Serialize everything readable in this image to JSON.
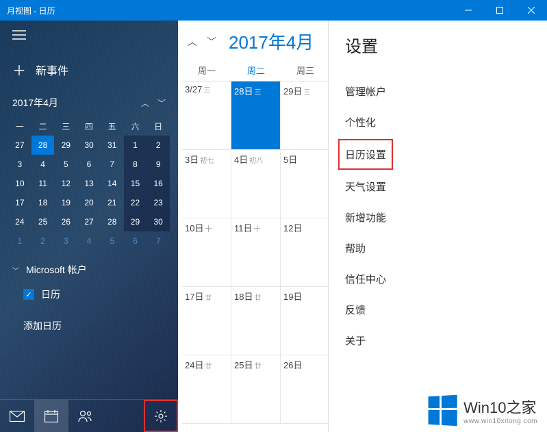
{
  "titlebar": {
    "title": "月视图 - 日历"
  },
  "sidebar": {
    "new_event": "新事件",
    "mini_month": "2017年4月",
    "dow": [
      "一",
      "二",
      "三",
      "四",
      "五",
      "六",
      "日"
    ],
    "weeks": [
      [
        {
          "n": "27",
          "p": true
        },
        {
          "n": "28",
          "t": true
        },
        {
          "n": "29"
        },
        {
          "n": "30"
        },
        {
          "n": "31"
        },
        {
          "n": "1",
          "w": true
        },
        {
          "n": "2",
          "w": true
        }
      ],
      [
        {
          "n": "3"
        },
        {
          "n": "4"
        },
        {
          "n": "5"
        },
        {
          "n": "6"
        },
        {
          "n": "7"
        },
        {
          "n": "8",
          "w": true
        },
        {
          "n": "9",
          "w": true
        }
      ],
      [
        {
          "n": "10"
        },
        {
          "n": "11"
        },
        {
          "n": "12"
        },
        {
          "n": "13"
        },
        {
          "n": "14"
        },
        {
          "n": "15",
          "w": true
        },
        {
          "n": "16",
          "w": true
        }
      ],
      [
        {
          "n": "17"
        },
        {
          "n": "18"
        },
        {
          "n": "19"
        },
        {
          "n": "20"
        },
        {
          "n": "21"
        },
        {
          "n": "22",
          "w": true
        },
        {
          "n": "23",
          "w": true
        }
      ],
      [
        {
          "n": "24"
        },
        {
          "n": "25"
        },
        {
          "n": "26"
        },
        {
          "n": "27"
        },
        {
          "n": "28"
        },
        {
          "n": "29",
          "w": true
        },
        {
          "n": "30",
          "w": true
        }
      ],
      [
        {
          "n": "1",
          "x": true
        },
        {
          "n": "2",
          "x": true
        },
        {
          "n": "3",
          "x": true
        },
        {
          "n": "4",
          "x": true
        },
        {
          "n": "5",
          "x": true
        },
        {
          "n": "6",
          "x": true
        },
        {
          "n": "7",
          "x": true
        }
      ]
    ],
    "account": "Microsoft 帐户",
    "calendar_label": "日历",
    "add_calendar": "添加日历"
  },
  "main": {
    "title": "2017年4月",
    "dow": [
      "周一",
      "周二",
      "周三"
    ],
    "dow_current": 1,
    "weeks": [
      [
        {
          "d": "3/27",
          "s": "三"
        },
        {
          "d": "28日",
          "s": "三",
          "t": true
        },
        {
          "d": "29日",
          "s": "三"
        }
      ],
      [
        {
          "d": "3日",
          "s": "初七"
        },
        {
          "d": "4日",
          "s": "初八"
        },
        {
          "d": "5日",
          "s": ""
        }
      ],
      [
        {
          "d": "10日",
          "s": "十"
        },
        {
          "d": "11日",
          "s": "十"
        },
        {
          "d": "12日",
          "s": ""
        }
      ],
      [
        {
          "d": "17日",
          "s": "廿"
        },
        {
          "d": "18日",
          "s": "廿"
        },
        {
          "d": "19日",
          "s": ""
        }
      ],
      [
        {
          "d": "24日",
          "s": "廿"
        },
        {
          "d": "25日",
          "s": "廿"
        },
        {
          "d": "26日",
          "s": ""
        }
      ]
    ]
  },
  "settings": {
    "title": "设置",
    "items": [
      "管理帐户",
      "个性化",
      "日历设置",
      "天气设置",
      "新增功能",
      "帮助",
      "信任中心",
      "反馈",
      "关于"
    ],
    "highlight": 2
  },
  "watermark": {
    "line1a": "Win10",
    "line1b": "之家",
    "line2": "www.win10xitong.com"
  }
}
